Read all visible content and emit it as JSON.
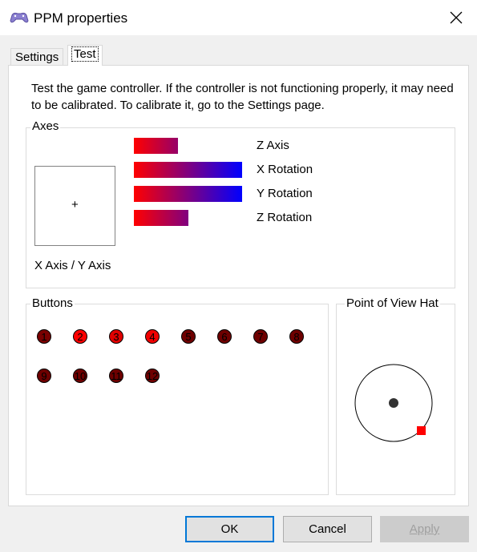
{
  "window": {
    "title": "PPM properties",
    "close_icon": "close-icon",
    "app_icon": "gamepad-icon"
  },
  "tabs": [
    {
      "label": "Settings",
      "active": false
    },
    {
      "label": "Test",
      "active": true
    }
  ],
  "description": "Test the game controller.  If the controller is not functioning properly, it may need to be calibrated.  To calibrate it, go to the Settings page.",
  "axes": {
    "label": "Axes",
    "xy_label": "X Axis / Y Axis",
    "crosshair": "+",
    "bars": [
      {
        "label": "Z Axis",
        "level": 0.41
      },
      {
        "label": "X Rotation",
        "level": 1.0
      },
      {
        "label": "Y Rotation",
        "level": 1.0
      },
      {
        "label": "Z Rotation",
        "level": 0.5
      }
    ]
  },
  "buttons": {
    "label": "Buttons",
    "items": [
      {
        "label": "1",
        "color": "#7a0000"
      },
      {
        "label": "2",
        "color": "#ff0000"
      },
      {
        "label": "3",
        "color": "#e00000"
      },
      {
        "label": "4",
        "color": "#f00000"
      },
      {
        "label": "5",
        "color": "#6e0000"
      },
      {
        "label": "6",
        "color": "#6e0000"
      },
      {
        "label": "7",
        "color": "#6e0000"
      },
      {
        "label": "8",
        "color": "#6e0000"
      },
      {
        "label": "9",
        "color": "#6e0000"
      },
      {
        "label": "10",
        "color": "#6e0000"
      },
      {
        "label": "11",
        "color": "#6e0000"
      },
      {
        "label": "12",
        "color": "#6e0000"
      }
    ]
  },
  "pov": {
    "label": "Point of View Hat",
    "indicator_color": "#ff0000",
    "center_color": "#333333"
  },
  "dialog_buttons": {
    "ok": "OK",
    "cancel": "Cancel",
    "apply": "Apply"
  },
  "colors": {
    "bar_start": "#ff0000",
    "bar_end": "#0000ff",
    "focus_border": "#0078d7"
  }
}
